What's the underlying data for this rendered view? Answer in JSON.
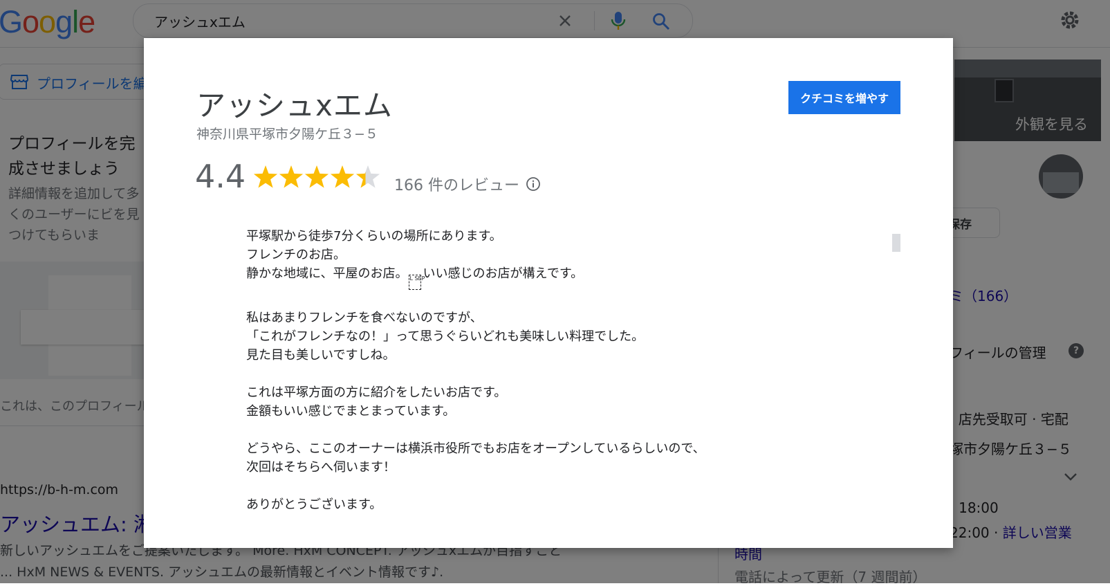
{
  "header": {
    "logo": [
      "G",
      "o",
      "o",
      "g",
      "l",
      "e"
    ],
    "logo_colors": [
      "#4285f4",
      "#ea4335",
      "#fbbc05",
      "#4285f4",
      "#34a853",
      "#ea4335"
    ],
    "search_value": "アッシュxエム"
  },
  "left": {
    "profile_button": "プロフィールを編",
    "complete_title": "プロフィールを完成させましょう",
    "complete_desc": "詳細情報を追加して多くのユーザーにビを見つけてもらいま",
    "notice": "これは、このプロフィール",
    "result_url": "https://b-h-m.com",
    "result_title": "アッシュエム: 湘",
    "snippet1": "新しいアッシュエムをご提案いたします。 More. HxM CONCEPT. アッシュxエムが目指すこと",
    "snippet2": "... HxM NEWS & EVENTS. アッシュエムの最新情報とイベント情報です♪."
  },
  "right": {
    "photo_label": "外観を見る",
    "save_label": "保存",
    "reviews_link": "ミ（166）",
    "manage": "フィールの管理",
    "help": "?",
    "services": "· 店先受取可 · 宅配",
    "address": "塚市夕陽ケ丘３−５",
    "hours1": ": 18:00",
    "hours2_prefix": "22:00 · ",
    "hours2_link": "詳しい営業",
    "hours3": "時間",
    "updated": "電話によって更新（7 週間前）"
  },
  "modal": {
    "title": "アッシュxエム",
    "address": "神奈川県平塚市夕陽ケ丘３−５",
    "rating": "4.4",
    "rating_value": 4.4,
    "review_count": "166 件のレビュー",
    "cta": "クチコミを増やす",
    "star_color": "#fbbc04",
    "star_empty_color": "#dadce0",
    "sep_glyph": "L SEP",
    "review_paragraphs": [
      [
        "平塚駅から徒歩7分くらいの場所にあります。",
        "フレンチのお店。"
      ],
      [
        "私はあまりフレンチを食べないのですが、",
        "「これがフレンチなの！」って思うぐらいどれも美味しい料理でした。",
        "見た目も美しいですしね。"
      ],
      [
        "これは平塚方面の方に紹介をしたいお店です。",
        "金額もいい感じでまとまっています。"
      ],
      [
        "どうやら、ここのオーナーは横浜市役所でもお店をオープンしているらしいので、",
        "次回はそちらへ伺います！"
      ],
      [
        "ありがとうございます。"
      ]
    ],
    "line3_before": "静かな地域に、平屋のお店。",
    "line3_after": "いい感じのお店が構えです。"
  }
}
